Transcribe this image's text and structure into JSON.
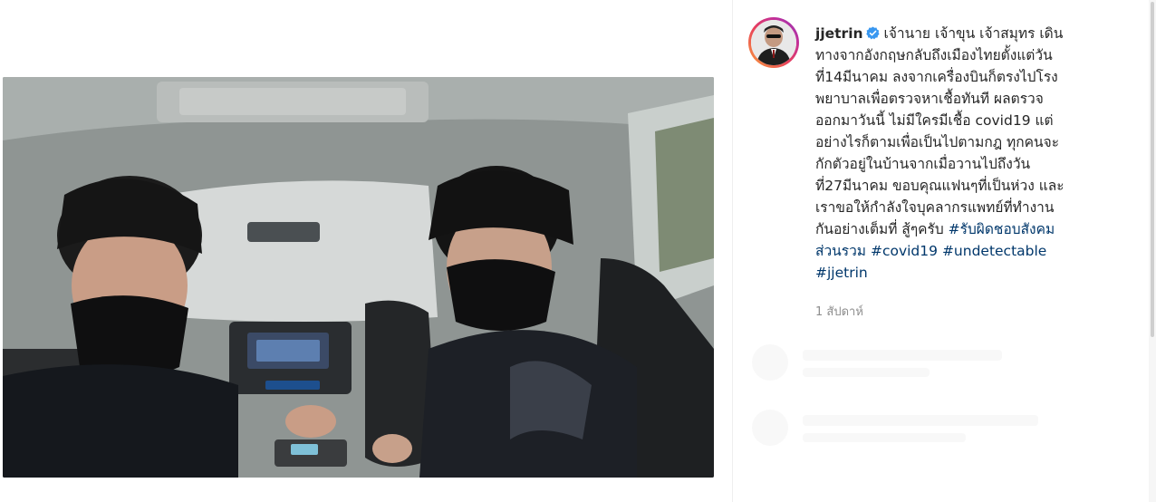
{
  "post": {
    "username": "jjetrin",
    "verified_icon": "verified-badge-icon",
    "caption_lines": [
      "เจ้านาย เจ้าขุน เจ้าสมุทร เดิน",
      "ทางจากอังกฤษกลับถึงเมืองไทยตั้งแต่วัน",
      "ที่14มีนาคม ลงจากเครื่องบินก็ตรงไปโรง",
      "พยาบาลเพื่อตรวจหาเชื้อทันที ผลตรวจ",
      "ออกมาวันนี้ ไม่มีใครมีเชื้อ covid19 แต่",
      "อย่างไรก็ตามเพื่อเป็นไปตามกฎ ทุกคนจะ",
      "กักตัวอยู่ในบ้านจากเมื่อวานไปถึงวัน",
      "ที่27มีนาคม ขอบคุณแฟนๆที่เป็นห่วง และ",
      "เราขอให้กำลังใจบุคลากรแพทย์ที่ทำงาน",
      "กันอย่างเต็มที่ สู้ๆครับ"
    ],
    "hashtags": {
      "tag1_part1": "#รับผิดชอบสังคม",
      "tag1_part2": "ส่วนรวม",
      "tag2": "#covid19",
      "tag3": "#undetectable",
      "tag4": "#jjetrin"
    },
    "timestamp": "1 สัปดาห์"
  },
  "colors": {
    "hashtag": "#00376b",
    "text": "#262626",
    "muted": "#8e8e8e",
    "verified": "#3897f0"
  }
}
